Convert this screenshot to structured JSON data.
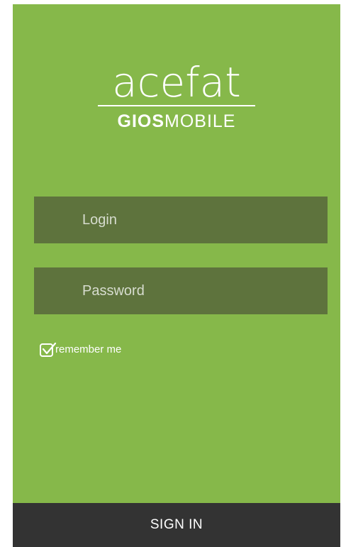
{
  "brand": {
    "name": "acefat",
    "sub_bold": "GIOS",
    "sub_light": "MOBILE"
  },
  "form": {
    "login_placeholder": "Login",
    "password_placeholder": "Password",
    "remember_label": "remember me",
    "remember_checked": true
  },
  "actions": {
    "signin_label": "SIGN IN"
  },
  "colors": {
    "background": "#86b84a",
    "field": "#5e733d",
    "button": "#333333",
    "text": "#ffffff"
  }
}
